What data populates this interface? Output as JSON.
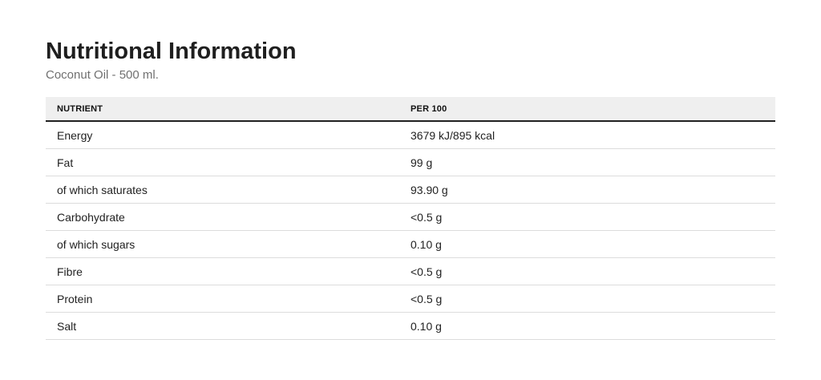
{
  "header": {
    "title": "Nutritional Information",
    "subtitle": "Coconut Oil - 500 ml."
  },
  "table": {
    "columns": [
      "NUTRIENT",
      "PER 100"
    ],
    "rows": [
      {
        "nutrient": "Energy",
        "value": "3679 kJ/895 kcal"
      },
      {
        "nutrient": "Fat",
        "value": "99 g"
      },
      {
        "nutrient": "of which saturates",
        "value": "93.90 g"
      },
      {
        "nutrient": "Carbohydrate",
        "value": "<0.5 g"
      },
      {
        "nutrient": "of which sugars",
        "value": "0.10 g"
      },
      {
        "nutrient": "Fibre",
        "value": "<0.5 g"
      },
      {
        "nutrient": "Protein",
        "value": "<0.5 g"
      },
      {
        "nutrient": "Salt",
        "value": "0.10 g"
      }
    ]
  }
}
